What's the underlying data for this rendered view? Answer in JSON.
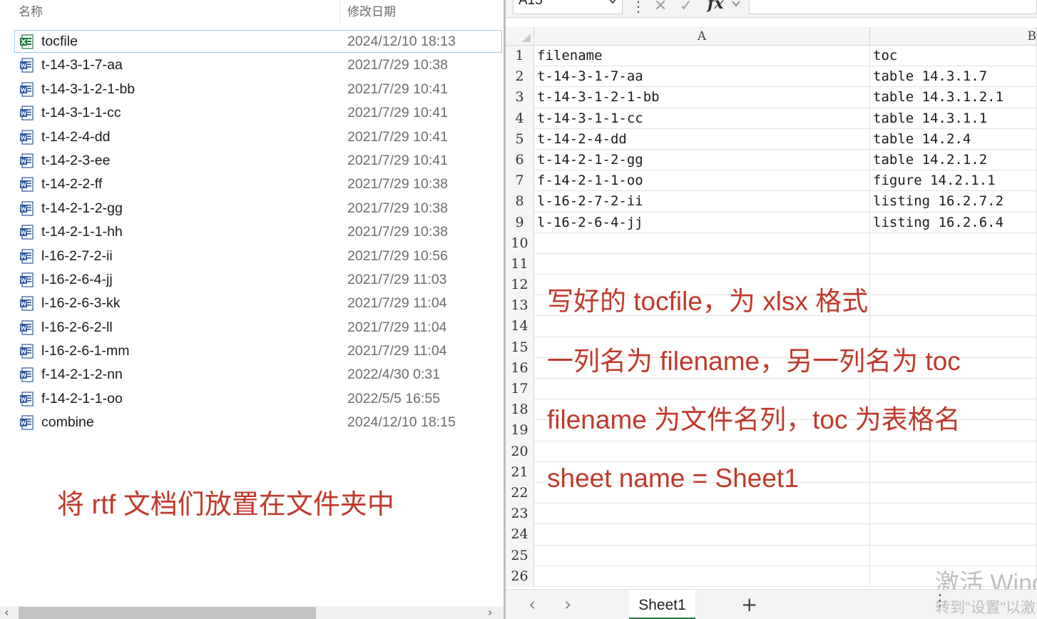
{
  "explorer": {
    "header": {
      "name": "名称",
      "date": "修改日期"
    },
    "files": [
      {
        "name": "tocfile",
        "date": "2024/12/10 18:13",
        "icon": "excel-file-icon",
        "selected": true
      },
      {
        "name": "t-14-3-1-7-aa",
        "date": "2021/7/29 10:38",
        "icon": "word-file-icon"
      },
      {
        "name": "t-14-3-1-2-1-bb",
        "date": "2021/7/29 10:41",
        "icon": "word-file-icon"
      },
      {
        "name": "t-14-3-1-1-cc",
        "date": "2021/7/29 10:41",
        "icon": "word-file-icon"
      },
      {
        "name": "t-14-2-4-dd",
        "date": "2021/7/29 10:41",
        "icon": "word-file-icon"
      },
      {
        "name": "t-14-2-3-ee",
        "date": "2021/7/29 10:41",
        "icon": "word-file-icon"
      },
      {
        "name": "t-14-2-2-ff",
        "date": "2021/7/29 10:38",
        "icon": "word-file-icon"
      },
      {
        "name": "t-14-2-1-2-gg",
        "date": "2021/7/29 10:38",
        "icon": "word-file-icon"
      },
      {
        "name": "t-14-2-1-1-hh",
        "date": "2021/7/29 10:38",
        "icon": "word-file-icon"
      },
      {
        "name": "l-16-2-7-2-ii",
        "date": "2021/7/29 10:56",
        "icon": "word-file-icon"
      },
      {
        "name": "l-16-2-6-4-jj",
        "date": "2021/7/29 11:03",
        "icon": "word-file-icon"
      },
      {
        "name": "l-16-2-6-3-kk",
        "date": "2021/7/29 11:04",
        "icon": "word-file-icon"
      },
      {
        "name": "l-16-2-6-2-ll",
        "date": "2021/7/29 11:04",
        "icon": "word-file-icon"
      },
      {
        "name": "l-16-2-6-1-mm",
        "date": "2021/7/29 11:04",
        "icon": "word-file-icon"
      },
      {
        "name": "f-14-2-1-2-nn",
        "date": "2022/4/30 0:31",
        "icon": "word-file-icon"
      },
      {
        "name": "f-14-2-1-1-oo",
        "date": "2022/5/5 16:55",
        "icon": "word-file-icon"
      },
      {
        "name": "combine",
        "date": "2024/12/10 18:15",
        "icon": "word-file-icon"
      }
    ],
    "note": "将 rtf 文档们放置在文件夹中",
    "scroll": {
      "left_arrow": "‹",
      "right_arrow": "›"
    }
  },
  "spreadsheet": {
    "name_box": "A15",
    "formula_dots": "⋮",
    "cancel_glyph": "✕",
    "accept_glyph": "✓",
    "fx_label": "fx",
    "formula_value": "",
    "columns": [
      "A",
      "B"
    ],
    "rows": [
      {
        "num": "1",
        "a": "filename",
        "b": "toc"
      },
      {
        "num": "2",
        "a": "t-14-3-1-7-aa",
        "b": "table 14.3.1.7"
      },
      {
        "num": "3",
        "a": "t-14-3-1-2-1-bb",
        "b": "table 14.3.1.2.1"
      },
      {
        "num": "4",
        "a": "t-14-3-1-1-cc",
        "b": "table 14.3.1.1"
      },
      {
        "num": "5",
        "a": "t-14-2-4-dd",
        "b": "table 14.2.4"
      },
      {
        "num": "6",
        "a": "t-14-2-1-2-gg",
        "b": "table 14.2.1.2"
      },
      {
        "num": "7",
        "a": "f-14-2-1-1-oo",
        "b": "figure 14.2.1.1"
      },
      {
        "num": "8",
        "a": "l-16-2-7-2-ii",
        "b": "listing 16.2.7.2"
      },
      {
        "num": "9",
        "a": "l-16-2-6-4-jj",
        "b": "listing 16.2.6.4"
      },
      {
        "num": "10",
        "a": "",
        "b": ""
      },
      {
        "num": "11",
        "a": "",
        "b": ""
      },
      {
        "num": "12",
        "a": "",
        "b": ""
      },
      {
        "num": "13",
        "a": "",
        "b": ""
      },
      {
        "num": "14",
        "a": "",
        "b": ""
      },
      {
        "num": "15",
        "a": "",
        "b": ""
      },
      {
        "num": "16",
        "a": "",
        "b": ""
      },
      {
        "num": "17",
        "a": "",
        "b": ""
      },
      {
        "num": "18",
        "a": "",
        "b": ""
      },
      {
        "num": "19",
        "a": "",
        "b": ""
      },
      {
        "num": "20",
        "a": "",
        "b": ""
      },
      {
        "num": "21",
        "a": "",
        "b": ""
      },
      {
        "num": "22",
        "a": "",
        "b": ""
      },
      {
        "num": "23",
        "a": "",
        "b": ""
      },
      {
        "num": "24",
        "a": "",
        "b": ""
      },
      {
        "num": "25",
        "a": "",
        "b": ""
      },
      {
        "num": "26",
        "a": "",
        "b": ""
      }
    ],
    "notes": [
      "写好的 tocfile，为 xlsx 格式",
      "一列名为 filename，另一列名为 toc",
      "filename 为文件名列，toc 为表格名",
      "sheet name = Sheet1"
    ],
    "watermark": {
      "line1": "激活 Wind",
      "line2": "转到\"设置\"以激"
    },
    "tabs": {
      "prev": "‹",
      "next": "›",
      "active": "Sheet1",
      "add": "+",
      "more": "⋮"
    }
  },
  "colors": {
    "note_red": "#c0392b",
    "excel_green": "#1d7a3c",
    "word_blue": "#2b579a",
    "selection_border": "#99c9ef"
  }
}
